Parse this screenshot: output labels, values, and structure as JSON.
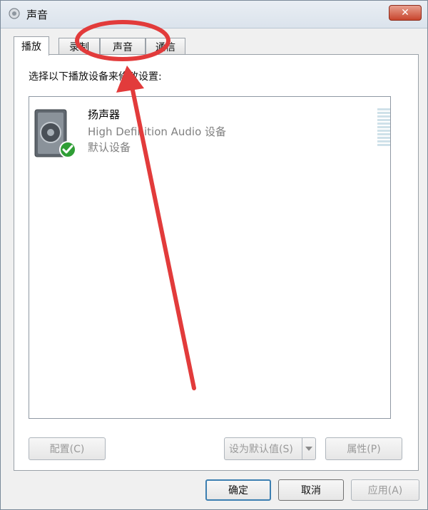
{
  "window": {
    "title": "声音",
    "close_label": "✕"
  },
  "tabs": [
    {
      "label": "播放",
      "active": true
    },
    {
      "label": "录制",
      "active": false
    },
    {
      "label": "声音",
      "active": false
    },
    {
      "label": "通信",
      "active": false
    }
  ],
  "panel": {
    "instruction": "选择以下播放设备来修改设置:"
  },
  "device": {
    "name": "扬声器",
    "description": "High Definition Audio 设备",
    "status": "默认设备"
  },
  "panel_buttons": {
    "configure": "配置(C)",
    "set_default": "设为默认值(S)",
    "properties": "属性(P)"
  },
  "dialog_buttons": {
    "ok": "确定",
    "cancel": "取消",
    "apply": "应用(A)"
  },
  "colors": {
    "annotation": "#e23b3b",
    "accent": "#3c7fb1"
  }
}
